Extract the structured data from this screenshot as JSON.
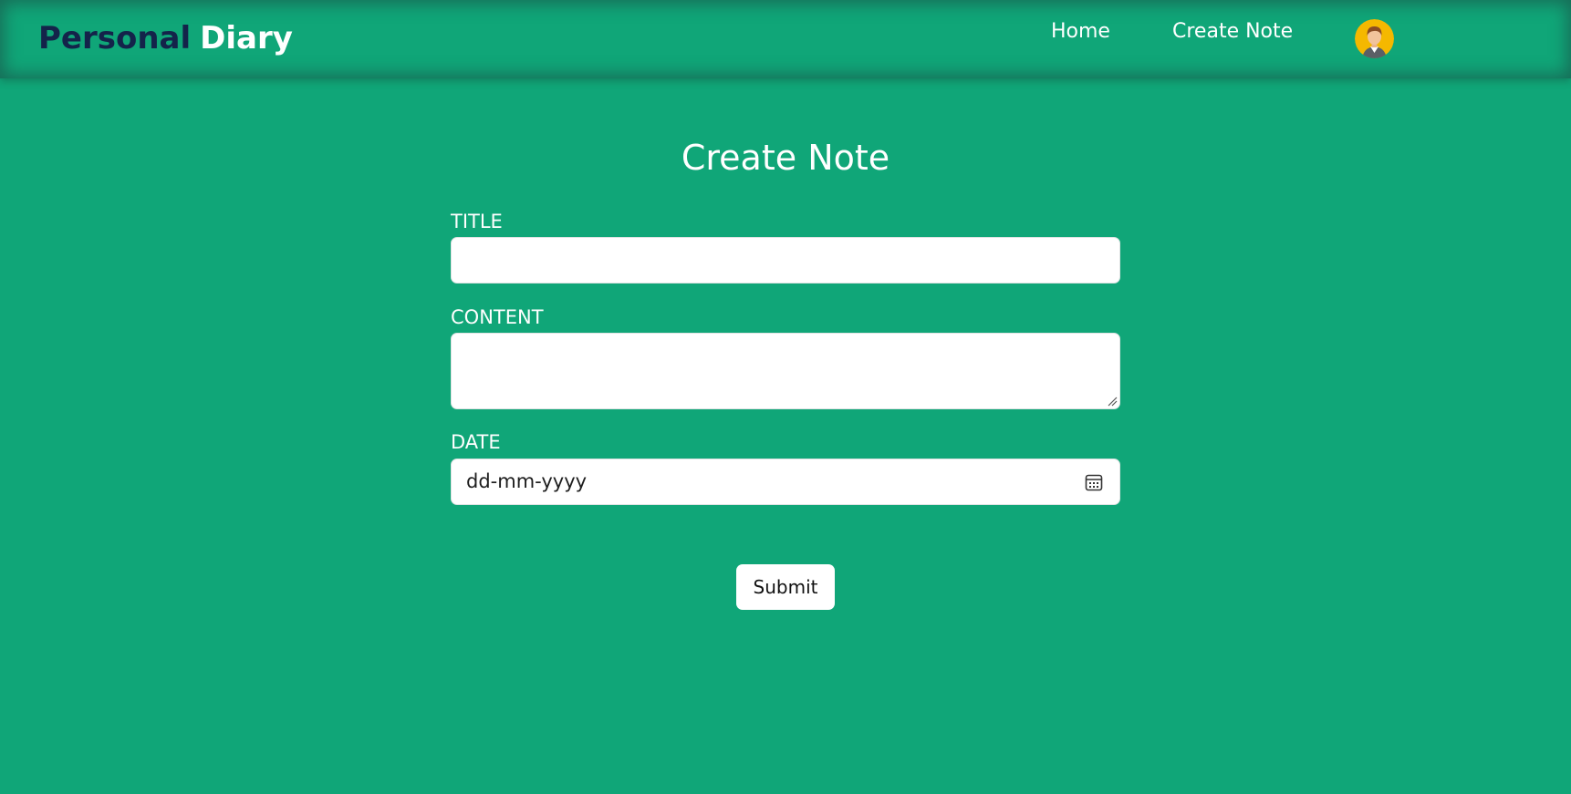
{
  "navbar": {
    "brand_part1": "Personal",
    "brand_part2": "Diary",
    "links": [
      {
        "label": "Home"
      },
      {
        "label": "Create Note"
      }
    ],
    "avatar_icon": "user-avatar-icon"
  },
  "form": {
    "heading": "Create Note",
    "title_label": "TITLE",
    "title_value": "",
    "content_label": "CONTENT",
    "content_value": "",
    "date_label": "DATE",
    "date_placeholder": "dd-mm-yyyy",
    "calendar_icon": "calendar-icon",
    "submit_label": "Submit"
  },
  "colors": {
    "background": "#10a678",
    "brand_dark": "#14234a",
    "text_light": "#ffffff",
    "avatar_bg": "#f5b800"
  }
}
